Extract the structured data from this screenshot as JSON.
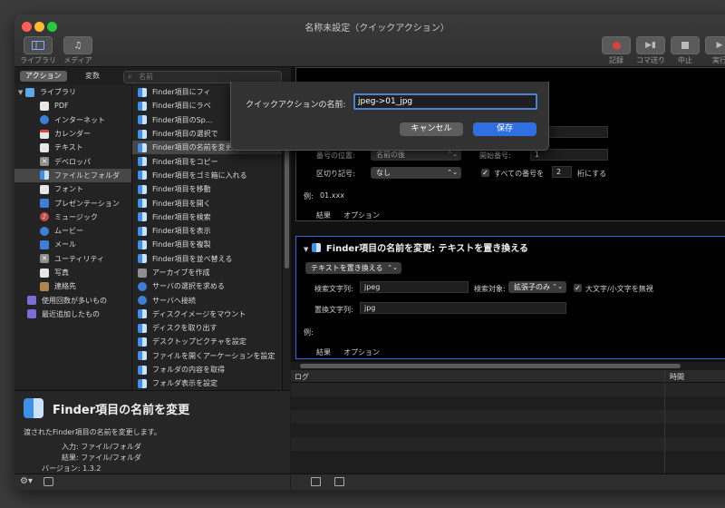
{
  "window": {
    "title": "名称未設定（クイックアクション）"
  },
  "toolbar": {
    "library_label": "ライブラリ",
    "media_label": "メディア",
    "record_label": "記録",
    "step_label": "コマ送り",
    "stop_label": "中止",
    "run_label": "実行"
  },
  "left_tabs": {
    "actions": "アクション",
    "variables": "変数",
    "search_placeholder": "名前"
  },
  "library": [
    "ライブラリ",
    "PDF",
    "インターネット",
    "カレンダー",
    "テキスト",
    "デベロッパ",
    "ファイルとフォルダ",
    "フォント",
    "プレゼンテーション",
    "ミュージック",
    "ムービー",
    "メール",
    "ユーティリティ",
    "写真",
    "連絡先",
    "使用回数が多いもの",
    "最近追加したもの"
  ],
  "actions": [
    "Finder項目にフィ",
    "Finder項目にラベ",
    "Finder項目のSp...",
    "Finder項目の選択で",
    "Finder項目の名前を変更",
    "Finder項目をコピー",
    "Finder項目をゴミ箱に入れる",
    "Finder項目を移動",
    "Finder項目を開く",
    "Finder項目を検索",
    "Finder項目を表示",
    "Finder項目を複製",
    "Finder項目を並べ替える",
    "アーカイブを作成",
    "サーバの選択を求める",
    "サーバへ接続",
    "ディスクイメージをマウント",
    "ディスクを取り出す",
    "デスクトップピクチャを設定",
    "ファイルを開くアーケーションを設定",
    "フォルダの内容を取得",
    "フォルダ表示を設定"
  ],
  "description": {
    "title": "Finder項目の名前を変更",
    "text": "渡されたFinder項目の名前を変更します。",
    "input": "入力: ファイル/フォルダ",
    "result": "結果: ファイル/フォルダ",
    "version": "バージョン: 1.3.2"
  },
  "card1": {
    "number_position_label": "番号の位置:",
    "number_position_value": "名前の後",
    "start_number_label": "開始番号:",
    "start_number_value": "1",
    "separator_label": "区切り記号:",
    "separator_value": "なし",
    "digits_check_label": "すべての番号を",
    "digits_value": "2",
    "digits_suffix": "桁にする",
    "example_label": "例:",
    "example_value": "01.xxx",
    "tab_results": "結果",
    "tab_options": "オプション"
  },
  "card2": {
    "title": "Finder項目の名前を変更: テキストを置き換える",
    "mode_value": "テキストを置き換える",
    "find_label": "検索文字列:",
    "find_value": "jpeg",
    "target_label": "検索対象:",
    "target_value": "拡張子のみ",
    "ignore_case_label": "大文字/小文字を無視",
    "replace_label": "置換文字列:",
    "replace_value": "jpg",
    "example_label": "例:",
    "tab_results": "結果",
    "tab_options": "オプション"
  },
  "log": {
    "col_log": "ログ",
    "col_time": "時間"
  },
  "sheet": {
    "label": "クイックアクションの名前:",
    "value": "jpeg->01_jpg",
    "cancel": "キャンセル",
    "save": "保存"
  }
}
